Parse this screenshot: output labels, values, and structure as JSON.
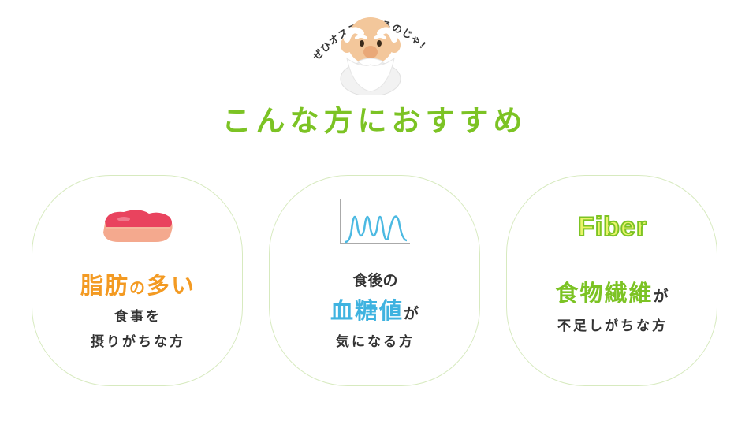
{
  "header": {
    "speech_text": "ぜひオススメするのじゃ!",
    "title": "こんな方におすすめ",
    "title_color": "#7cc324"
  },
  "cards": [
    {
      "icon": "meat-icon",
      "highlight": "脂肪",
      "particle": "の",
      "highlight2": "多い",
      "line1": "食事を",
      "line2": "摂りがちな方",
      "accent": "#f39a22"
    },
    {
      "icon": "blood-sugar-graph-icon",
      "top": "食後の",
      "highlight": "血糖値",
      "particle": "が",
      "line2": "気になる方",
      "accent": "#3fb3e0"
    },
    {
      "icon": "fiber-icon",
      "icon_text": "Fiber",
      "highlight": "食物繊維",
      "particle": "が",
      "line2": "不足しがちな方",
      "accent": "#7cc324"
    }
  ]
}
